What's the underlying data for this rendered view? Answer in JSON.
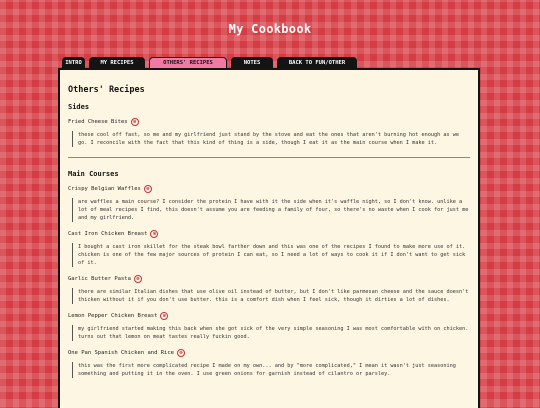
{
  "site": {
    "title": "My Cookbook"
  },
  "tabs": [
    {
      "label": "INTRO",
      "active": false
    },
    {
      "label": "MY RECIPES",
      "active": false
    },
    {
      "label": "OTHERS' RECIPES",
      "active": true
    },
    {
      "label": "NOTES",
      "active": false
    },
    {
      "label": "BACK TO FUN/OTHER",
      "active": false
    }
  ],
  "page": {
    "heading": "Others' Recipes"
  },
  "badge": {
    "glyph": "⊗",
    "icon": "heart-icon",
    "color": "#c7313c"
  },
  "sections": [
    {
      "heading": "Sides",
      "recipes": [
        {
          "title": "Fried Cheese Bites",
          "note": "these cool off fast, so me and my girlfriend just stand by the stove and eat the ones that aren't burning hot enough as we go. I reconcile with the fact that this kind of thing is a side, though I eat it as the main course when I make it."
        }
      ]
    },
    {
      "heading": "Main Courses",
      "recipes": [
        {
          "title": "Crispy Belgian Waffles",
          "note": "are waffles a main course? I consider the protein I have with it the side when it's waffle night, so I don't know. unlike a lot of meal recipes I find, this doesn't assume you are feeding a family of four, so there's no waste when I cook for just me and my girlfriend."
        },
        {
          "title": "Cast Iron Chicken Breast",
          "note": "I bought a cast iron skillet for the steak bowl farther down and this was one of the recipes I found to make more use of it. chicken is one of the few major sources of protein I can eat, so I need a lot of ways to cook it if I don't want to get sick of it."
        },
        {
          "title": "Garlic Butter Pasta",
          "note": "there are similar Italian dishes that use olive oil instead of butter, but I don't like parmesan cheese and the sauce doesn't thicken without it if you don't use butter. this is a comfort dish when I feel sick, though it dirties a lot of dishes."
        },
        {
          "title": "Lemon Pepper Chicken Breast",
          "note": "my girlfriend started making this back when she got sick of the very simple seasoning I was most comfortable with on chicken. turns out that lemon on meat tastes really fuckin good."
        },
        {
          "title": "One Pan Spanish Chicken and Rice",
          "note": "this was the first more complicated recipe I made on my own... and by \"more complicated,\" I mean it wasn't just seasoning something and putting it in the oven. I use green onions for garnish instead of cilantro or parsley."
        }
      ]
    }
  ]
}
